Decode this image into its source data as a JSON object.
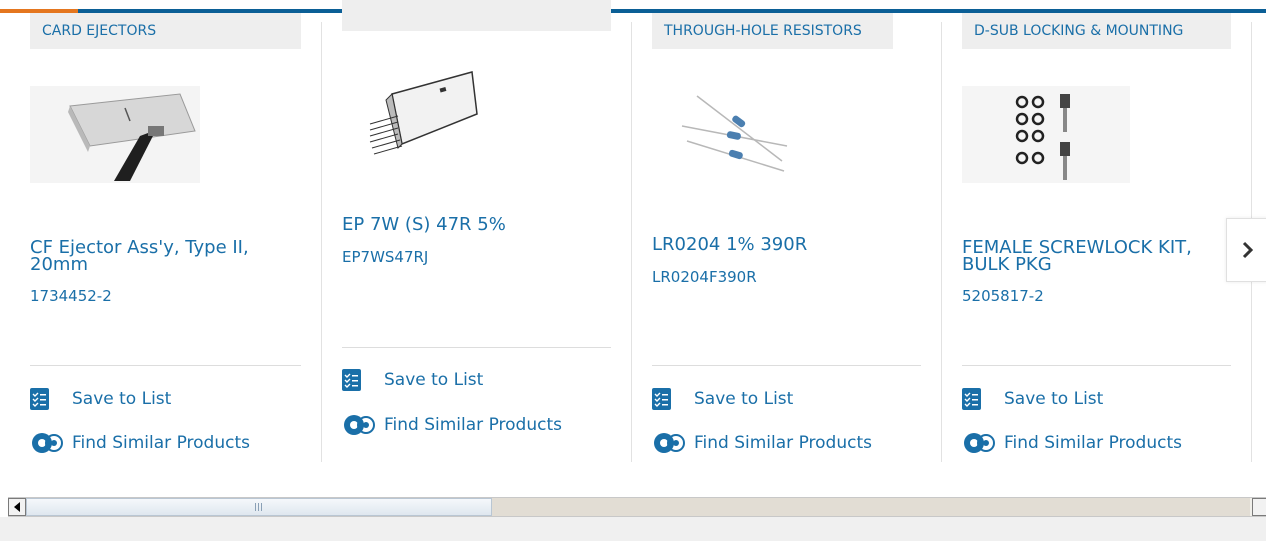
{
  "cards": [
    {
      "category": "CARD EJECTORS",
      "title": "CF Ejector Ass'y, Type II, 20mm",
      "part_number": "1734452-2",
      "image_icon": "card-ejector-photo",
      "save_label": "Save to List",
      "similar_label": "Find Similar Products"
    },
    {
      "category": "",
      "title": "EP 7W (S) 47R 5%",
      "part_number": "EP7WS47RJ",
      "image_icon": "resistor-network-drawing",
      "save_label": "Save to List",
      "similar_label": "Find Similar Products"
    },
    {
      "category": "THROUGH-HOLE RESISTORS",
      "title": "LR0204 1% 390R",
      "part_number": "LR0204F390R",
      "image_icon": "axial-resistors-photo",
      "save_label": "Save to List",
      "similar_label": "Find Similar Products"
    },
    {
      "category": "D-SUB LOCKING & MOUNTING",
      "title": "FEMALE SCREWLOCK KIT, BULK PKG",
      "part_number": "5205817-2",
      "image_icon": "screwlock-kit-photo",
      "save_label": "Save to List",
      "similar_label": "Find Similar Products"
    }
  ],
  "carousel": {
    "next_icon": "chevron-right-icon"
  },
  "scrollbar": {
    "left_icon": "arrow-left-icon",
    "right_icon": "arrow-right-icon",
    "grip_icon": "grip-icon"
  },
  "colors": {
    "accent_blue": "#0b5f96",
    "accent_orange": "#e4761f",
    "link_blue": "#1a6fa8",
    "tab_bg": "#eeeeee"
  }
}
